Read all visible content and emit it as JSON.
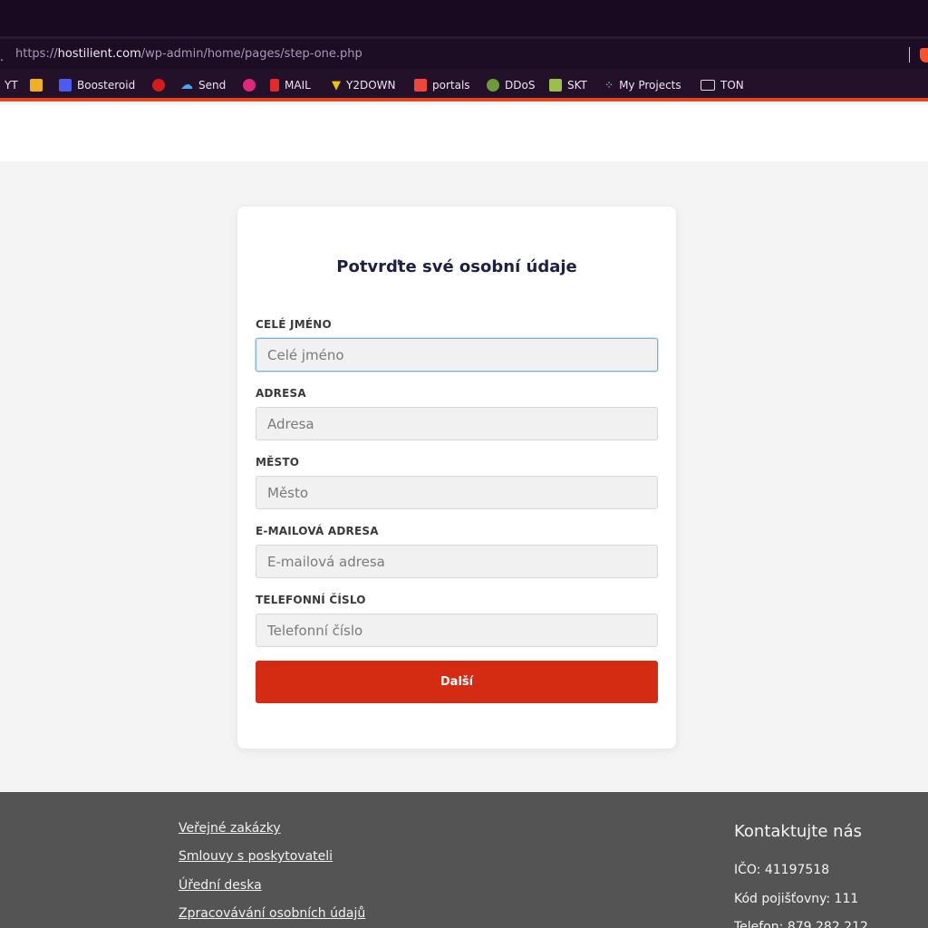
{
  "browser": {
    "url_scheme": "https://",
    "url_host": "hostilient.com",
    "url_path": "/wp-admin/home/pages/step-one.php",
    "bookmarks": [
      {
        "label": "YT",
        "icon": "yt-icon",
        "color": ""
      },
      {
        "label": "",
        "icon": "yellow-folder-icon",
        "color": "#f2b01e"
      },
      {
        "label": "Boosteroid",
        "icon": "boosteroid-icon",
        "color": "#4b5cf2"
      },
      {
        "label": "",
        "icon": "red-dot-icon",
        "color": "#d61b1b"
      },
      {
        "label": "Send",
        "icon": "cloud-upload-icon",
        "color": "#4aa8f0"
      },
      {
        "label": "",
        "icon": "pink-flower-icon",
        "color": "#e0287a"
      },
      {
        "label": "MAIL",
        "icon": "mail-icon",
        "color": "#e22a2a"
      },
      {
        "label": "Y2DOWN",
        "icon": "y2down-icon",
        "color": "#9b4df2"
      },
      {
        "label": "portals",
        "icon": "portals-icon",
        "color": "#f0453b"
      },
      {
        "label": "DDoS",
        "icon": "ddos-icon",
        "color": "#6d9b3a"
      },
      {
        "label": "SKT",
        "icon": "skt-icon",
        "color": "#9ac04a"
      },
      {
        "label": "My Projects",
        "icon": "dots-icon",
        "color": "#a9e2d6"
      },
      {
        "label": "TON",
        "icon": "folder-icon",
        "color": ""
      }
    ]
  },
  "form": {
    "title": "Potvrďte své osobní údaje",
    "fields": [
      {
        "label": "CELÉ JMÉNO",
        "placeholder": "Celé jméno"
      },
      {
        "label": "ADRESA",
        "placeholder": "Adresa"
      },
      {
        "label": "MĚSTO",
        "placeholder": "Město"
      },
      {
        "label": "E-MAILOVÁ ADRESA",
        "placeholder": "E-mailová adresa"
      },
      {
        "label": "TELEFONNÍ ČÍSLO",
        "placeholder": "Telefonní číslo"
      }
    ],
    "submit_label": "Další"
  },
  "footer": {
    "links": [
      "Veřejné zakázky",
      "Smlouvy s poskytovateli",
      "Úřední deska",
      "Zpracovávání osobních údajů"
    ],
    "contact_title": "Kontaktujte nás",
    "contact_lines": [
      "IČO: 41197518",
      "Kód pojišťovny: 111",
      "Telefon: 879 282 212"
    ]
  },
  "colors": {
    "accent": "#d42c12",
    "title": "#1e1f45",
    "footer_bg": "#545454"
  }
}
